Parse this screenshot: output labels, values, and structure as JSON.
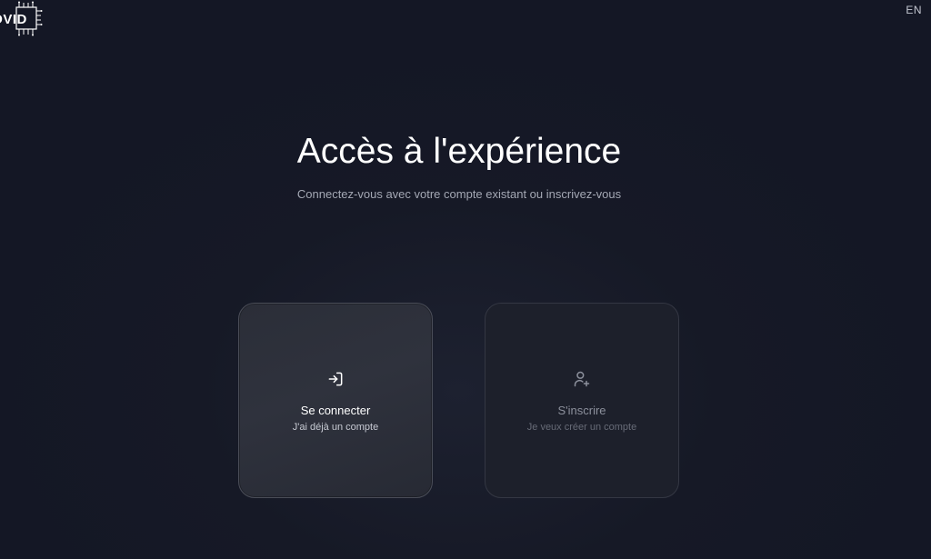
{
  "header": {
    "logo_text": "DVID",
    "language_toggle": "EN"
  },
  "main": {
    "title": "Accès à l'expérience",
    "subtitle": "Connectez-vous avec votre compte existant ou inscrivez-vous"
  },
  "cards": {
    "login": {
      "icon": "login-icon",
      "label": "Se connecter",
      "sublabel": "J'ai déjà un compte"
    },
    "signup": {
      "icon": "user-plus-icon",
      "label": "S'inscrire",
      "sublabel": "Je veux créer un compte"
    }
  },
  "colors": {
    "background": "#161926",
    "login_card": "#2d303b",
    "signup_card": "#1d202b"
  }
}
